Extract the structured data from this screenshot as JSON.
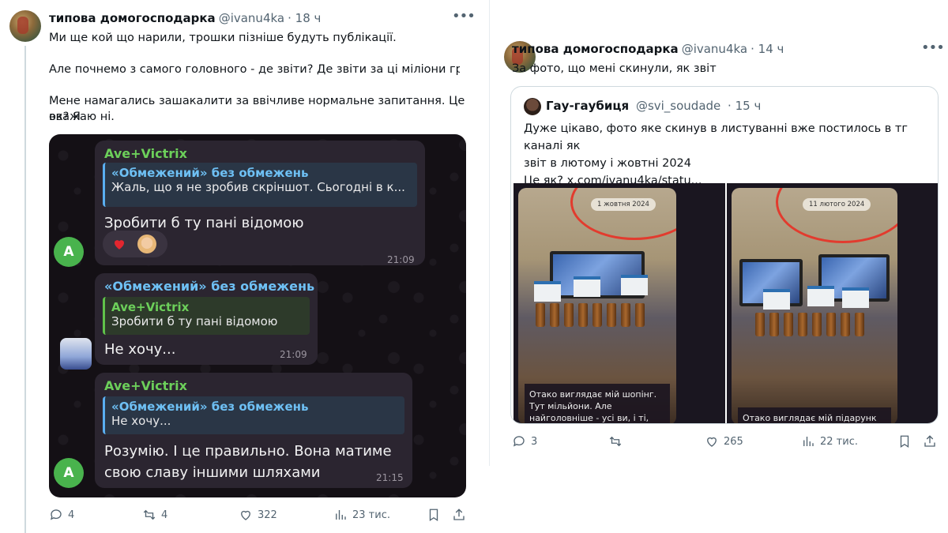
{
  "left_tweet": {
    "author_name": "типова домогосподарка",
    "handle": "@ivanu4ka",
    "time": "· 18 ч",
    "text_lines": [
      "Ми ще кой що нарили, трошки пізніше будуть публікації.",
      "Але почнемо з самого головного - де звіти? Де звіти за ці міліони гривень?",
      "Мене намагались зашакалити за ввічливе нормальне запитання. Це ок? Я",
      "вважаю ні."
    ],
    "telegram": {
      "messages": [
        {
          "sender": "Ave+Victrix",
          "quote_name": "«Обмежений» без обмежень",
          "quote_text": "Жаль, що я не зробив скріншот. Сьогодні в к...",
          "text": "Зробити б ту пані відомою",
          "time": "21:09",
          "avatar_letter": "A"
        },
        {
          "sender": "«Обмежений» без обмежень",
          "quote_name": "Ave+Victrix",
          "quote_text": "Зробити б ту пані відомою",
          "text": "Не хочу...",
          "time": "21:09"
        },
        {
          "sender": "Ave+Victrix",
          "quote_name": "«Обмежений» без обмежень",
          "quote_text": "Не хочу...",
          "text_lines": [
            "Розумію. І це правильно.  Вона матиме",
            "свою славу іншими шляхами"
          ],
          "time": "21:15",
          "avatar_letter": "A"
        }
      ]
    },
    "actions": {
      "replies": "4",
      "reposts": "4",
      "likes": "322",
      "views": "23 тис."
    }
  },
  "right_tweet": {
    "author_name": "типова домогосподарка",
    "handle": "@ivanu4ka",
    "time": "· 14 ч",
    "text": "За фото, що мені скинули, як звіт",
    "quoted": {
      "author_name": "Гау-гаубиця",
      "handle": "@svi_soudade",
      "time": "· 15 ч",
      "text_lines": [
        "Дуже цікаво, фото яке скинув в листуванні вже постилось в тг каналі як",
        "звіт в лютому і жовтні 2024",
        "Це як?  x.com/ivanu4ka/statu..."
      ],
      "photos": [
        {
          "date": "1 жовтня 2024",
          "caption": "Отако виглядає мій шопінг. Тут мільйони. Але найголовніше - усі ви, і ті, хто тут, і ті, хто не тут"
        },
        {
          "date": "11 лютого 2024",
          "caption": "Отако виглядає мій підарунк"
        }
      ]
    },
    "actions": {
      "replies": "3",
      "reposts": "",
      "likes": "265",
      "views": "22 тис."
    }
  },
  "colors": {
    "text": "#0f1419",
    "secondary": "#536471",
    "tg_green": "#6ccf5a",
    "tg_blue": "#6ec0f4",
    "highlight_red": "#e23b2e"
  }
}
